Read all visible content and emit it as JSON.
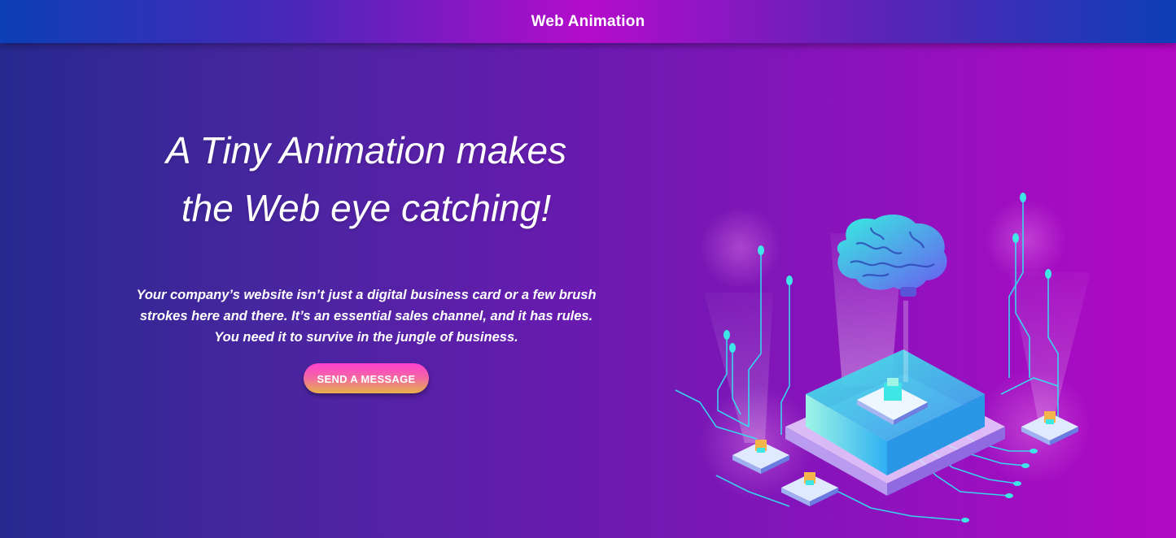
{
  "header": {
    "title": "Web Animation"
  },
  "hero": {
    "headline_line1": "A Tiny Animation makes",
    "headline_line2": "the Web eye catching!",
    "body_line1": "Your company’s website isn’t just a digital business card or a few brush",
    "body_line2": "strokes here and there. It’s an essential sales channel, and it has rules.",
    "body_line3": "You need it to survive in the jungle of business.",
    "cta_label": "SEND A MESSAGE"
  },
  "colors": {
    "background_start": "#27298f",
    "background_end": "#b309c4",
    "header_blue": "#0c3fb8",
    "header_magenta": "#b40ccb",
    "cta_top": "#ff3fd0",
    "cta_bottom": "#e8b24a",
    "accent_cyan": "#3ee6e6"
  },
  "illustration": {
    "icon": "ai-brain-chip-icon"
  }
}
